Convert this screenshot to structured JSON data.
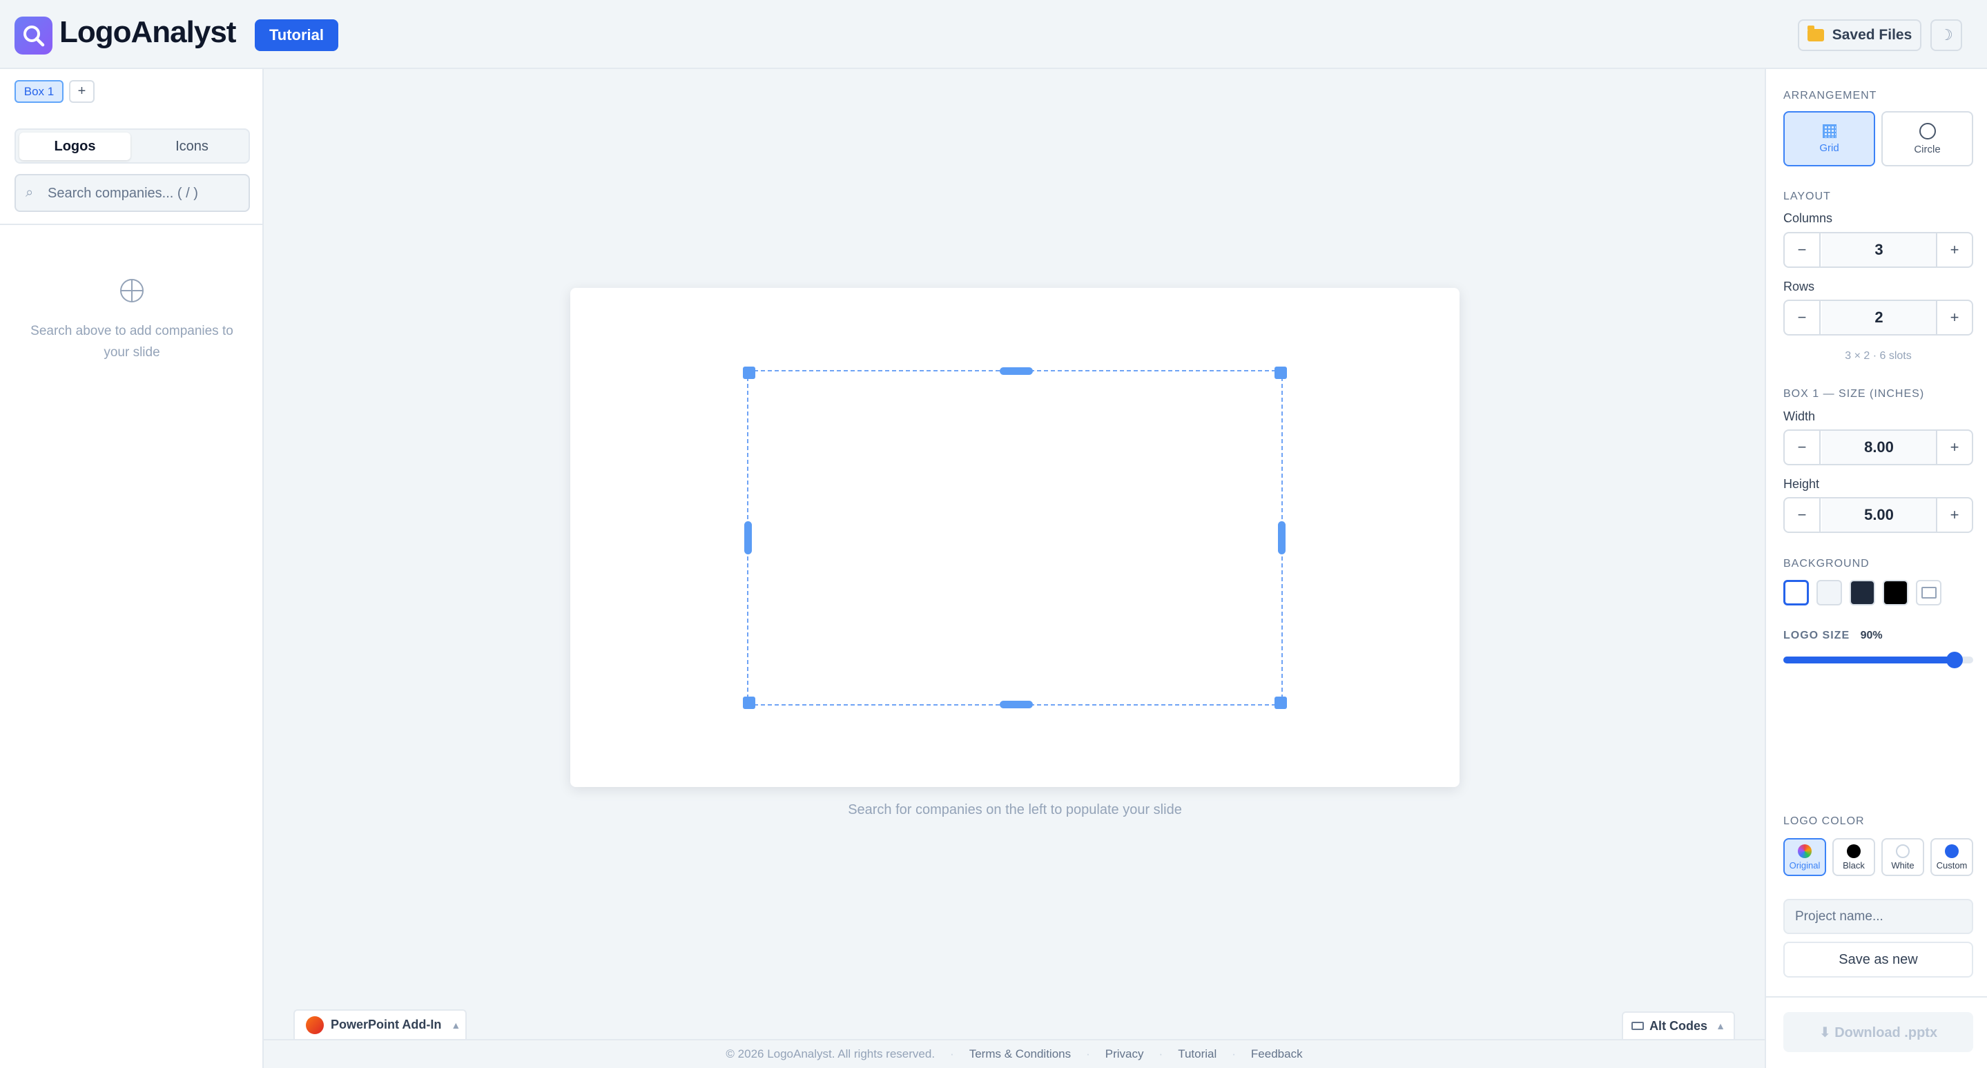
{
  "app": {
    "title": "LogoAnalyst",
    "tutorial_label": "Tutorial",
    "saved_files_label": "Saved Files",
    "theme_toggle_glyph": "☽"
  },
  "left": {
    "box_tabs": [
      {
        "label": "Box 1",
        "active": true
      }
    ],
    "add_box_label": "+",
    "modes": [
      "Logos",
      "Icons"
    ],
    "active_mode": "Logos",
    "search": {
      "glyph": "⌕",
      "placeholder": "Search companies... ( / )",
      "value": ""
    },
    "empty_state": "Search above to add companies to your slide"
  },
  "canvas": {
    "hint": "Search for companies on the left to populate your slide",
    "powerpoint_addin_label": "PowerPoint Add-In",
    "alt_codes_label": "Alt Codes",
    "caret": "▲"
  },
  "footer": {
    "copyright": "© 2026 LogoAnalyst. All rights reserved.",
    "separator": "·",
    "links": [
      "Terms & Conditions",
      "Privacy",
      "Tutorial",
      "Feedback"
    ]
  },
  "right": {
    "arrangement": {
      "label": "Arrangement",
      "options": [
        "Grid",
        "Circle"
      ],
      "selected": "Grid"
    },
    "layout": {
      "label": "Layout",
      "columns_label": "Columns",
      "columns": "3",
      "rows_label": "Rows",
      "rows": "2",
      "summary": "3 × 2 · 6 slots"
    },
    "box_size": {
      "label": "Box 1 — Size (inches)",
      "width_label": "Width",
      "width": "8.00",
      "height_label": "Height",
      "height": "5.00"
    },
    "background": {
      "label": "Background",
      "swatches": [
        "#ffffff",
        "#f1f5f9",
        "#1e293b",
        "#000000",
        "transparent"
      ],
      "selected_index": 0
    },
    "logo_size": {
      "label": "Logo Size",
      "value_text": "90%",
      "value": 90
    },
    "logo_color": {
      "label": "Logo Color",
      "options": [
        {
          "label": "Original",
          "color": "multicolor"
        },
        {
          "label": "Black",
          "color": "#000000"
        },
        {
          "label": "White",
          "color": "#ffffff"
        },
        {
          "label": "Custom",
          "color": "#2563eb"
        }
      ],
      "selected": "Original"
    },
    "project_name_placeholder": "Project name...",
    "save_new_label": "Save as new",
    "download_label": "⬇ Download .pptx"
  },
  "stepper_symbols": {
    "minus": "−",
    "plus": "+"
  },
  "colors": {
    "accent": "#2563eb",
    "selection": "#5b9cf5",
    "selected_bg": "#dbeafe"
  }
}
